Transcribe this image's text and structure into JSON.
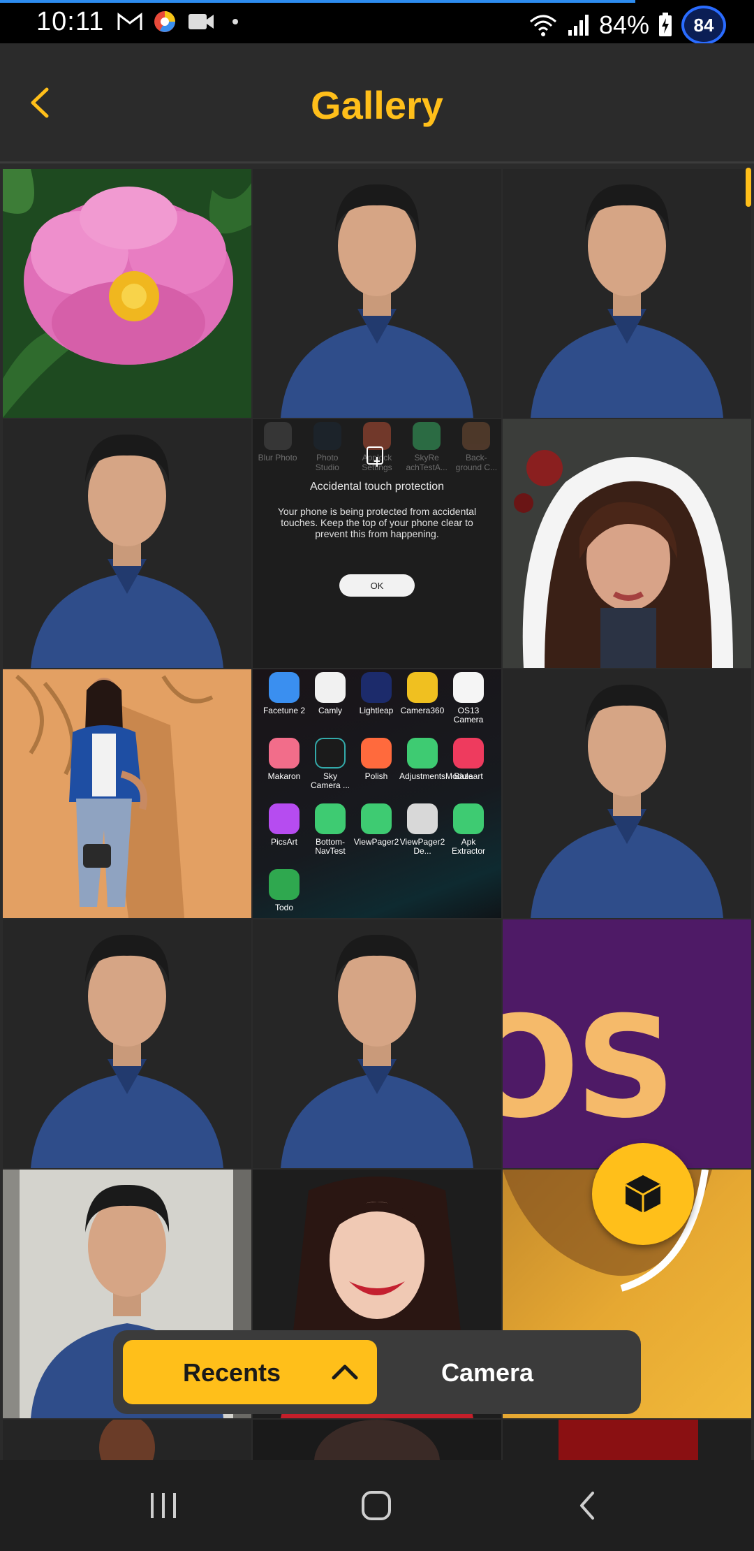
{
  "status_bar": {
    "time": "10:11",
    "battery": "84%",
    "badge": "84",
    "accent": "#2d8cf0"
  },
  "header": {
    "title": "Gallery",
    "back_icon": "chevron-left-icon",
    "accent": "#ffbf1a"
  },
  "grid": {
    "tiles": [
      {
        "kind": "flower"
      },
      {
        "kind": "portrait"
      },
      {
        "kind": "portrait"
      },
      {
        "kind": "portrait"
      },
      {
        "kind": "screenshot"
      },
      {
        "kind": "woman-sticker"
      },
      {
        "kind": "woman-orange"
      },
      {
        "kind": "app-grid"
      },
      {
        "kind": "portrait"
      },
      {
        "kind": "portrait"
      },
      {
        "kind": "portrait"
      },
      {
        "kind": "os-graphic"
      },
      {
        "kind": "portrait-light"
      },
      {
        "kind": "woman-smiling"
      },
      {
        "kind": "yellow-closeup"
      }
    ]
  },
  "screenshot_tile": {
    "apps": [
      "Blur Photo",
      "Photo Studio",
      "Applock Settings",
      "SkyRe achTestA...",
      "Back-ground C..."
    ],
    "dialog_title": "Accidental touch protection",
    "dialog_body": "Your phone is being protected from accidental touches. Keep the top of your phone clear to prevent this from happening.",
    "ok_label": "OK"
  },
  "app_grid_tile": {
    "apps": [
      {
        "label": "Facetune 2",
        "color": "#3a8ff0"
      },
      {
        "label": "Camly",
        "color": "#f1f1f1"
      },
      {
        "label": "Lightleap",
        "color": "#1c2b6b"
      },
      {
        "label": "Camera360",
        "color": "#f0c020"
      },
      {
        "label": "OS13 Camera",
        "color": "#f5f5f5"
      },
      {
        "label": "Makaron",
        "color": "#f26d8a"
      },
      {
        "label": "Sky Camera ...",
        "color": "#1b1b1b"
      },
      {
        "label": "Polish",
        "color": "#ff6a3d"
      },
      {
        "label": "AdjustmentsModule",
        "color": "#3ecb72"
      },
      {
        "label": "Bazaart",
        "color": "#ee3b5e"
      },
      {
        "label": "PicsArt",
        "color": "#b64cf0"
      },
      {
        "label": "Bottom-NavTest",
        "color": "#3ecb72"
      },
      {
        "label": "ViewPager2",
        "color": "#3ecb72"
      },
      {
        "label": "ViewPager2 De...",
        "color": "#d8d8d8"
      },
      {
        "label": "Apk Extractor",
        "color": "#3ecb72"
      },
      {
        "label": "Todo",
        "color": "#2fa84f"
      }
    ]
  },
  "os_tile": {
    "text": "OS"
  },
  "album_switcher": {
    "recents_label": "Recents",
    "camera_label": "Camera"
  },
  "fab": {
    "icon": "cube-icon"
  },
  "nav": {
    "recents_icon": "recent-apps-icon",
    "home_icon": "home-icon",
    "back_icon": "back-icon"
  }
}
